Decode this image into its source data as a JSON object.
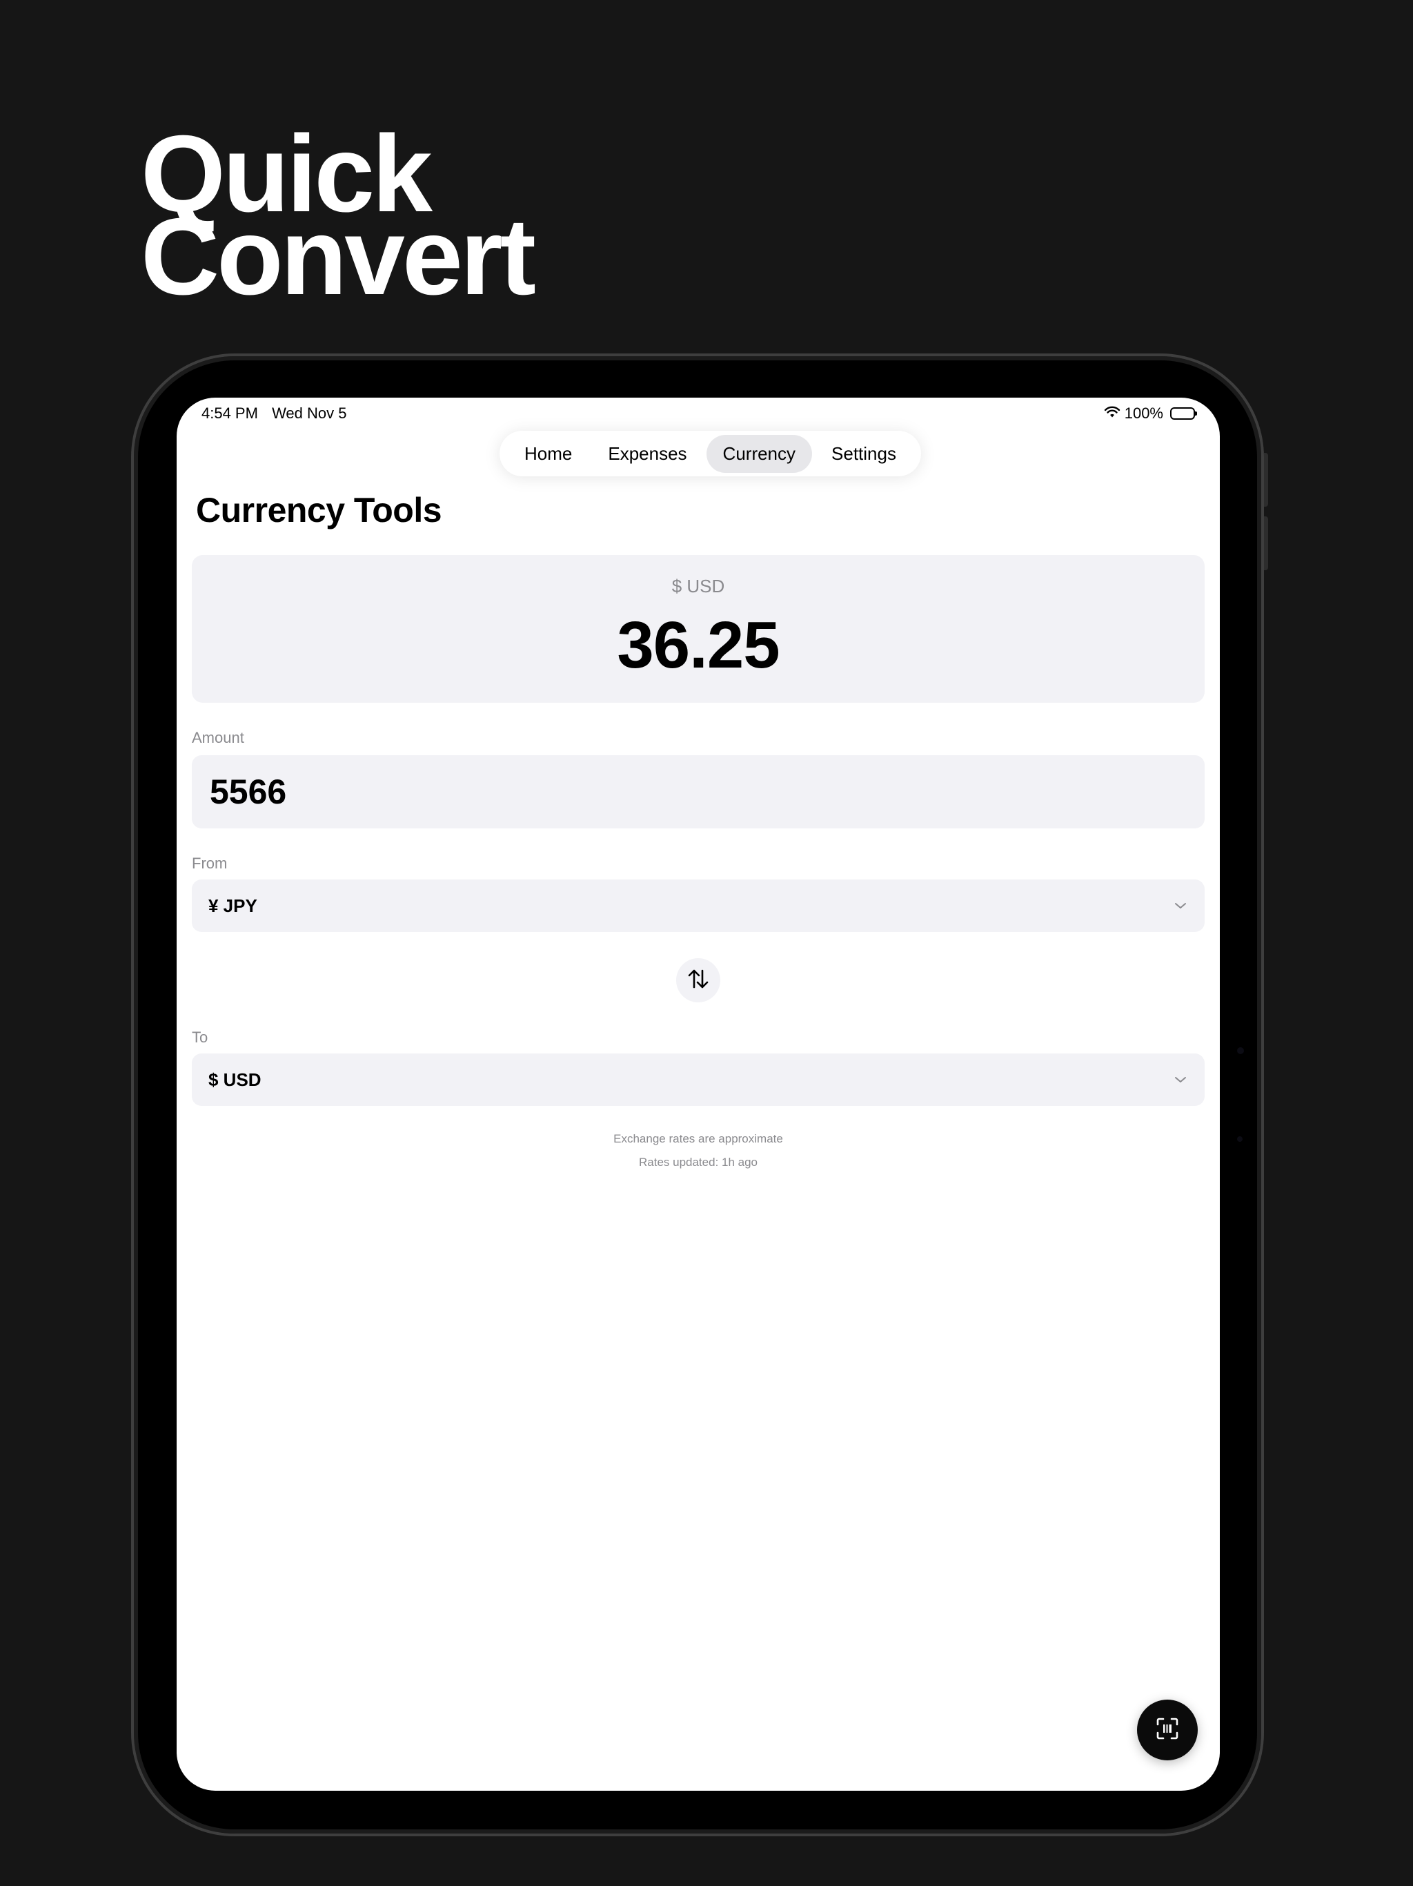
{
  "headline": {
    "line1": "Quick",
    "line2": "Convert"
  },
  "status_bar": {
    "time": "4:54 PM",
    "date": "Wed Nov 5",
    "battery_text": "100%",
    "battery_level": 1.0
  },
  "tabs": [
    {
      "label": "Home",
      "active": false
    },
    {
      "label": "Expenses",
      "active": false
    },
    {
      "label": "Currency",
      "active": true
    },
    {
      "label": "Settings",
      "active": false
    }
  ],
  "page": {
    "title": "Currency Tools"
  },
  "result": {
    "currency_label": "$ USD",
    "value": "36.25"
  },
  "amount": {
    "label": "Amount",
    "value": "5566"
  },
  "from": {
    "label": "From",
    "value": "¥ JPY"
  },
  "to": {
    "label": "To",
    "value": "$ USD"
  },
  "notes": {
    "disclaimer": "Exchange rates are approximate",
    "updated": "Rates updated: 1h ago"
  },
  "icons": {
    "wifi": "wifi-icon",
    "battery": "battery-icon",
    "chevron": "chevron-down-icon",
    "swap": "swap-vertical-icon",
    "scan": "scan-icon"
  },
  "colors": {
    "background": "#161616",
    "screen": "#ffffff",
    "card": "#f2f2f6",
    "secondary_text": "#8a8a8e",
    "active_tab": "#e7e7ea",
    "fab": "#0b0b0b"
  }
}
